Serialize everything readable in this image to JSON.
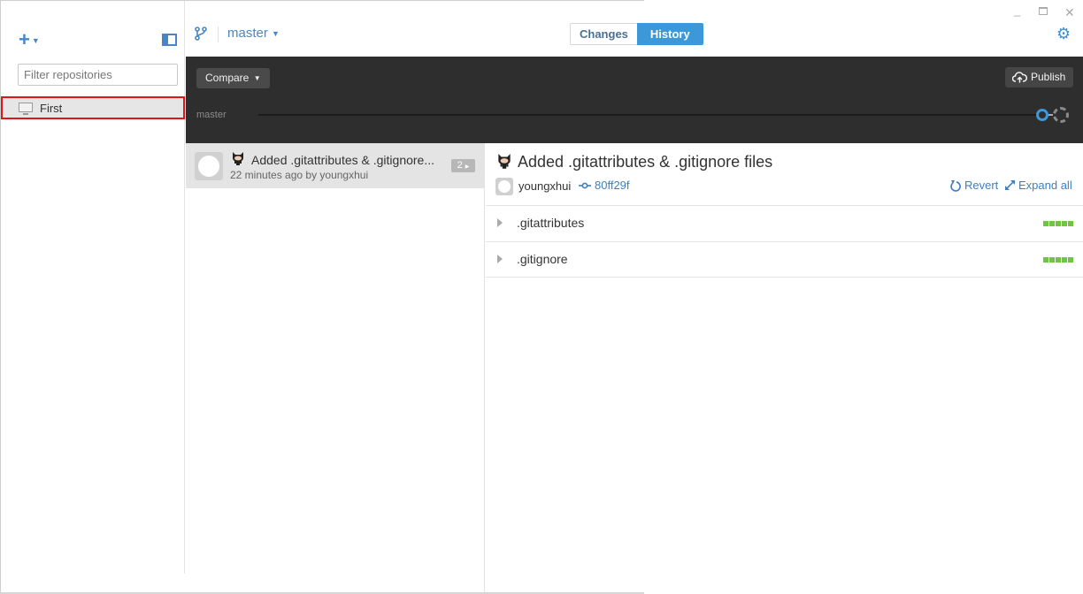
{
  "window": {
    "controls": {
      "minimize": "_",
      "maximize": "",
      "close": "✕"
    }
  },
  "sidebar": {
    "add_icon": "plus-icon",
    "filter": {
      "placeholder": "Filter repositories",
      "value": ""
    },
    "repositories": [
      {
        "name": "First",
        "icon": "monitor-icon",
        "selected": true
      }
    ]
  },
  "toolbar": {
    "branch_icon": "branch-icon",
    "branch": "master",
    "tabs": [
      {
        "label": "Changes",
        "active": false
      },
      {
        "label": "History",
        "active": true
      }
    ],
    "settings_icon": "gear-icon"
  },
  "timeline": {
    "compare_label": "Compare",
    "publish_label": "Publish",
    "branch_label": "master"
  },
  "commits": [
    {
      "title": "Added .gitattributes & .gitignore...",
      "meta": "22 minutes ago by youngxhui",
      "file_count": "2",
      "selected": true
    }
  ],
  "detail": {
    "title": "Added .gitattributes & .gitignore files",
    "author": "youngxhui",
    "sha": "80ff29f",
    "revert_label": "Revert",
    "expand_label": "Expand all",
    "files": [
      {
        "name": ".gitattributes",
        "additions_blocks": 5
      },
      {
        "name": ".gitignore",
        "additions_blocks": 5
      }
    ]
  },
  "colors": {
    "accent": "#3d98da",
    "link": "#3f7fc1",
    "addition": "#6cc644",
    "timeline_bg": "#2e2e2e",
    "selection_outline": "#e0141a"
  }
}
